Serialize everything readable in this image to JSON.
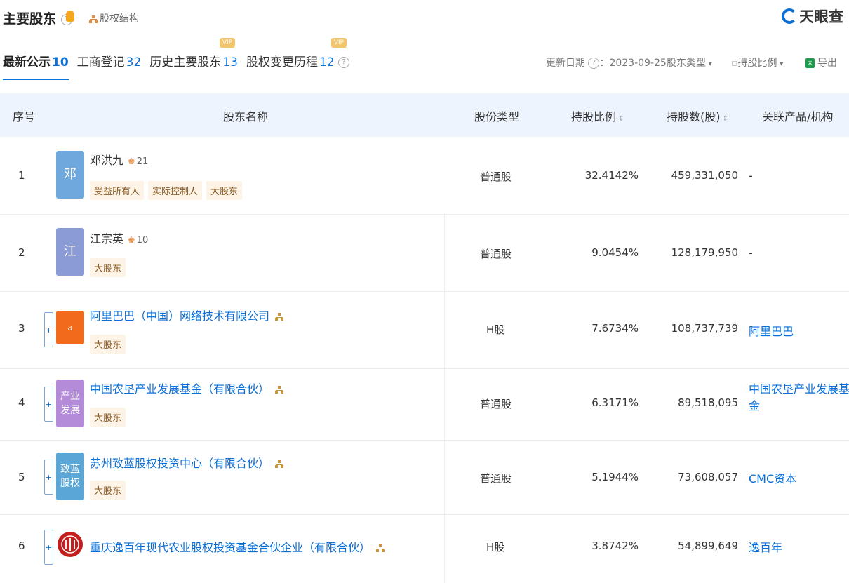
{
  "header": {
    "title": "主要股东",
    "structure_label": "股权结构",
    "logo_text": "天眼查"
  },
  "tabs": [
    {
      "label": "最新公示",
      "count": "10"
    },
    {
      "label": "工商登记",
      "count": "32"
    },
    {
      "label": "历史主要股东",
      "count": "13"
    },
    {
      "label": "股权变更历程",
      "count": "12"
    }
  ],
  "toolbar": {
    "update_label": "更新日期",
    "update_date": "2023-09-25",
    "shareholder_type": "股东类型",
    "holding_ratio": "持股比例",
    "export": "导出"
  },
  "table": {
    "columns": [
      "序号",
      "股东名称",
      "股份类型",
      "持股比例",
      "持股数(股)",
      "关联产品/机构"
    ],
    "rows": [
      {
        "index": "1",
        "avatar": "邓",
        "name": "邓洪九",
        "count": "21",
        "tags": [
          "受益所有人",
          "实际控制人",
          "大股东"
        ],
        "type": "普通股",
        "ratio": "32.4142%",
        "shares": "459,331,050",
        "related": "-"
      },
      {
        "index": "2",
        "avatar": "江",
        "name": "江宗英",
        "count": "10",
        "tags": [
          "大股东"
        ],
        "type": "普通股",
        "ratio": "9.0454%",
        "shares": "128,179,950",
        "related": "-"
      },
      {
        "index": "3",
        "avatar": "",
        "name": "阿里巴巴（中国）网络技术有限公司",
        "tags": [
          "大股东"
        ],
        "type": "H股",
        "ratio": "7.6734%",
        "shares": "108,737,739",
        "related": "阿里巴巴"
      },
      {
        "index": "4",
        "avatar_lines": [
          "产业",
          "发展"
        ],
        "name": "中国农垦产业发展基金（有限合伙）",
        "tags": [
          "大股东"
        ],
        "type": "普通股",
        "ratio": "6.3171%",
        "shares": "89,518,095",
        "related_lines": [
          "中国农垦产业发展基",
          "金"
        ]
      },
      {
        "index": "5",
        "avatar_lines": [
          "致蓝",
          "股权"
        ],
        "name": "苏州致蓝股权投资中心（有限合伙）",
        "tags": [
          "大股东"
        ],
        "type": "普通股",
        "ratio": "5.1944%",
        "shares": "73,608,057",
        "related": "CMC资本"
      },
      {
        "index": "6",
        "name": "重庆逸百年现代农业股权投资基金合伙企业（有限合伙）",
        "type": "H股",
        "ratio": "3.8742%",
        "shares": "54,899,649",
        "related": "逸百年"
      }
    ]
  },
  "colors": {
    "accent": "#0a6fd8",
    "header_bg": "#eef4fe",
    "tag_bg": "#fdf3e6"
  }
}
